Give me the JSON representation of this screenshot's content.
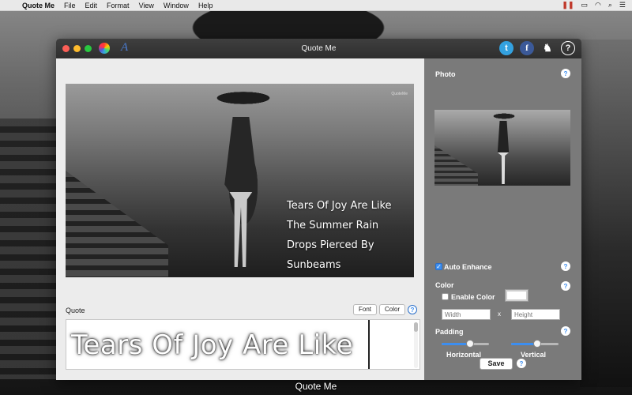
{
  "menubar": {
    "apple": "",
    "app_name": "Quote Me",
    "items": [
      "File",
      "Edit",
      "Format",
      "View",
      "Window",
      "Help"
    ],
    "status_icons": [
      "pause-icon",
      "airplay-icon",
      "wifi-icon",
      "search-icon",
      "list-icon"
    ]
  },
  "window": {
    "title": "Quote Me",
    "toolbar_left_icons": [
      "color-wheel-icon",
      "font-icon"
    ],
    "toolbar_right_icons": [
      "twitter-icon",
      "facebook-icon",
      "lion-icon",
      "help-icon"
    ],
    "font_icon_glyph": "A"
  },
  "editor": {
    "preview_brand": "QuoteMe",
    "preview_quote_lines": [
      "Tears Of Joy Are Like",
      "The Summer Rain",
      "Drops Pierced By",
      "Sunbeams"
    ],
    "quote_label": "Quote",
    "font_button": "Font",
    "color_button": "Color",
    "help_glyph": "?",
    "quote_text": "Tears Of Joy Are Like"
  },
  "sidebar": {
    "photo_label": "Photo",
    "auto_enhance_label": "Auto Enhance",
    "auto_enhance_checked": true,
    "color_label": "Color",
    "enable_color_label": "Enable Color",
    "enable_color_checked": false,
    "enable_color_swatch": "#ffffff",
    "width_placeholder": "Width",
    "height_placeholder": "Height",
    "dim_separator": "x",
    "padding_label": "Padding",
    "horizontal_label": "Horizontal",
    "vertical_label": "Vertical",
    "horizontal_value": 0.6,
    "vertical_value": 0.55,
    "save_label": "Save",
    "help_glyph": "?"
  },
  "dock": {
    "label": "Quote Me"
  },
  "colors": {
    "accent": "#3c8ef0",
    "titlebar": "#333333",
    "sidebar_bg": "#7a7a7a"
  }
}
